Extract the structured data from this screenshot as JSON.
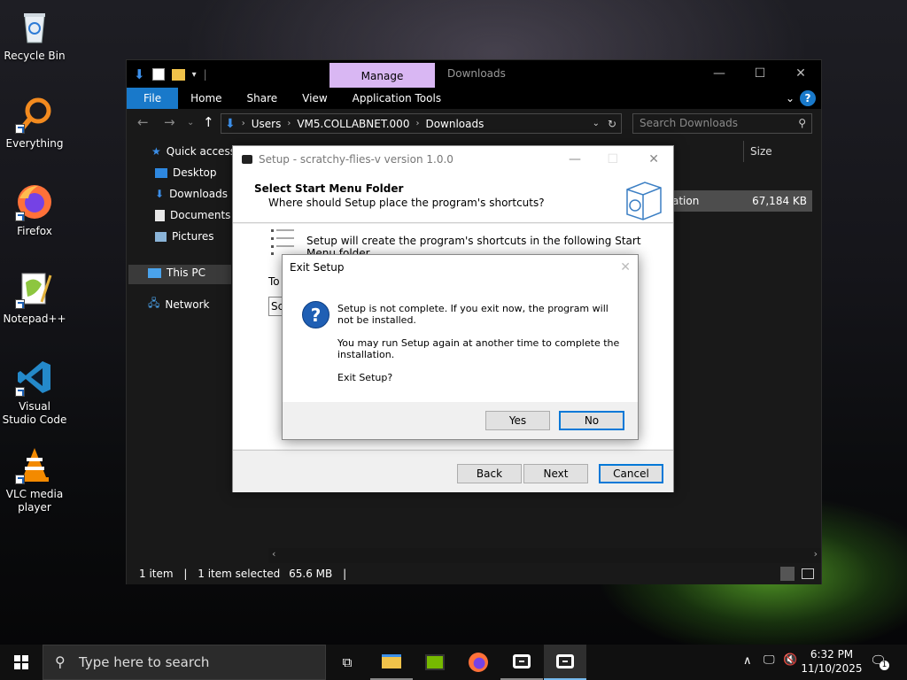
{
  "desktop": {
    "icons": [
      {
        "label": "Recycle Bin"
      },
      {
        "label": "Everything"
      },
      {
        "label": "Firefox"
      },
      {
        "label": "Notepad++"
      },
      {
        "label": "Visual Studio Code"
      },
      {
        "label": "VLC media player"
      }
    ]
  },
  "explorer": {
    "manage_tab": "Manage",
    "title_crumb": "Downloads",
    "ribbon": {
      "file": "File",
      "home": "Home",
      "share": "Share",
      "view": "View",
      "app_tools": "Application Tools",
      "help": "?"
    },
    "address": [
      "Users",
      "VM5.COLLABNET.000",
      "Downloads"
    ],
    "search_placeholder": "Search Downloads",
    "sidebar": [
      "Quick access",
      "Desktop",
      "Downloads",
      "Documents",
      "Pictures",
      "This PC",
      "Network"
    ],
    "column_size": "Size",
    "file_row": {
      "type_fragment": "ation",
      "size": "67,184 KB"
    },
    "status": {
      "count": "1 item",
      "selected": "1 item selected",
      "size": "65.6 MB"
    }
  },
  "setup": {
    "title": "Setup - scratchy-flies-v version 1.0.0",
    "heading": "Select Start Menu Folder",
    "subheading": "Where should Setup place the program's shortcuts?",
    "body_text": "Setup will create the program's shortcuts in the following Start Menu folder.",
    "to_label": "To",
    "folder_value": "Scr",
    "buttons": {
      "back": "Back",
      "next": "Next",
      "cancel": "Cancel"
    }
  },
  "exit_dialog": {
    "title": "Exit Setup",
    "message1": "Setup is not complete. If you exit now, the program will not be installed.",
    "message2": "You may run Setup again at another time to complete the installation.",
    "message3": "Exit Setup?",
    "yes": "Yes",
    "no": "No"
  },
  "taskbar": {
    "search_placeholder": "Type here to search",
    "time": "6:32 PM",
    "date": "11/10/2025",
    "notification_count": "1"
  }
}
